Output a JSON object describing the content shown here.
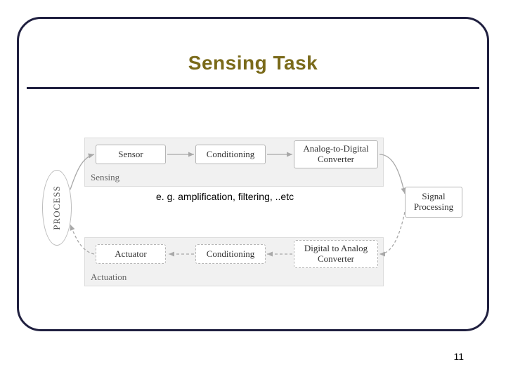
{
  "title": "Sensing Task",
  "annotation": "e. g. amplification, filtering, ..etc",
  "page_number": "11",
  "process_label": "PROCESS",
  "sensing": {
    "group_label": "Sensing",
    "sensor": "Sensor",
    "conditioning": "Conditioning",
    "adc": "Analog-to-Digital Converter"
  },
  "actuation": {
    "group_label": "Actuation",
    "actuator": "Actuator",
    "conditioning": "Conditioning",
    "dac": "Digital to Analog Converter"
  },
  "signal_processing": "Signal Processing",
  "chart_data": {
    "type": "diagram",
    "title": "Sensing Task",
    "nodes": [
      {
        "id": "process",
        "label": "PROCESS",
        "shape": "ellipse"
      },
      {
        "id": "sensor",
        "label": "Sensor",
        "group": "Sensing"
      },
      {
        "id": "conditioning_s",
        "label": "Conditioning",
        "group": "Sensing"
      },
      {
        "id": "adc",
        "label": "Analog-to-Digital Converter",
        "group": "Sensing"
      },
      {
        "id": "signal_processing",
        "label": "Signal Processing"
      },
      {
        "id": "dac",
        "label": "Digital to Analog Converter",
        "group": "Actuation",
        "optional": true
      },
      {
        "id": "conditioning_a",
        "label": "Conditioning",
        "group": "Actuation",
        "optional": true
      },
      {
        "id": "actuator",
        "label": "Actuator",
        "group": "Actuation",
        "optional": true
      }
    ],
    "edges": [
      {
        "from": "process",
        "to": "sensor",
        "style": "solid"
      },
      {
        "from": "sensor",
        "to": "conditioning_s",
        "style": "solid"
      },
      {
        "from": "conditioning_s",
        "to": "adc",
        "style": "solid"
      },
      {
        "from": "adc",
        "to": "signal_processing",
        "style": "solid"
      },
      {
        "from": "signal_processing",
        "to": "dac",
        "style": "dashed"
      },
      {
        "from": "dac",
        "to": "conditioning_a",
        "style": "dashed"
      },
      {
        "from": "conditioning_a",
        "to": "actuator",
        "style": "dashed"
      },
      {
        "from": "actuator",
        "to": "process",
        "style": "dashed"
      }
    ],
    "groups": [
      {
        "id": "Sensing",
        "label": "Sensing"
      },
      {
        "id": "Actuation",
        "label": "Actuation"
      }
    ],
    "annotation": "e. g. amplification, filtering, ..etc"
  }
}
